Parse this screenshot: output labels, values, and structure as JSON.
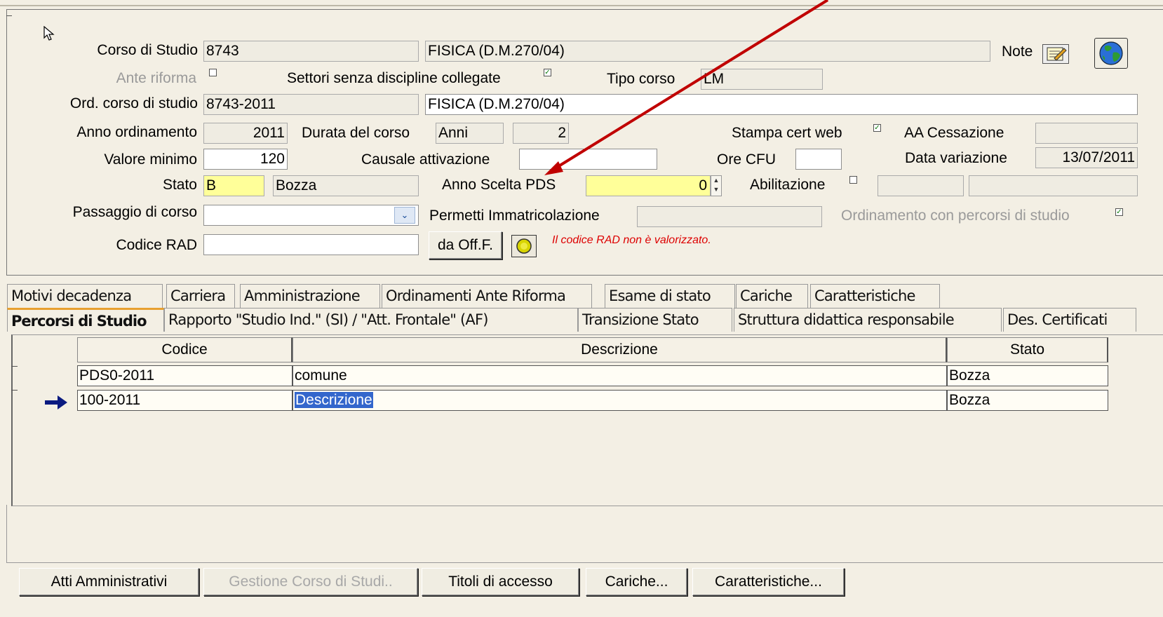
{
  "form": {
    "corso_di_studio_label": "Corso di Studio",
    "corso_code": "8743",
    "corso_name": "FISICA (D.M.270/04)",
    "note_label": "Note",
    "ante_riforma_label": "Ante riforma",
    "settori_label": "Settori senza discipline collegate",
    "tipo_corso_label": "Tipo corso",
    "tipo_corso_value": "LM",
    "ord_corso_label": "Ord. corso di studio",
    "ord_corso_code": "8743-2011",
    "ord_corso_name": "FISICA (D.M.270/04)",
    "anno_ordinamento_label": "Anno ordinamento",
    "anno_ordinamento_value": "2011",
    "durata_label": "Durata del corso",
    "durata_unit": "Anni",
    "durata_value": "2",
    "stampa_cert_label": "Stampa cert web",
    "aa_cessazione_label": "AA Cessazione",
    "aa_cessazione_value": "",
    "valore_minimo_label": "Valore minimo",
    "valore_minimo_value": "120",
    "causale_label": "Causale attivazione",
    "causale_value": "",
    "ore_cfu_label": "Ore CFU",
    "ore_cfu_value": "",
    "data_variazione_label": "Data variazione",
    "data_variazione_value": "13/07/2011",
    "stato_label": "Stato",
    "stato_code": "B",
    "stato_desc": "Bozza",
    "anno_scelta_label": "Anno Scelta PDS",
    "anno_scelta_value": "0",
    "abilitazione_label": "Abilitazione",
    "passaggio_label": "Passaggio di corso",
    "passaggio_value": "",
    "permetti_label": "Permetti Immatricolazione",
    "ordinamento_percorsi_label": "Ordinamento con percorsi di studio",
    "codice_rad_label": "Codice RAD",
    "codice_rad_value": "",
    "da_off_label": "da Off.F.",
    "rad_warning": "Il codice RAD non è valorizzato."
  },
  "tabs_row1": [
    "Motivi decadenza",
    "Carriera",
    "Amministrazione",
    "Ordinamenti Ante Riforma",
    "Esame di stato",
    "Cariche",
    "Caratteristiche"
  ],
  "tabs_row2": [
    "Percorsi di Studio",
    "Rapporto \"Studio Ind.\" (SI) / \"Att. Frontale\" (AF)",
    "Transizione Stato",
    "Struttura didattica responsabile",
    "Des. Certificati"
  ],
  "table": {
    "headers": [
      "Codice",
      "Descrizione",
      "Stato"
    ],
    "rows": [
      {
        "codice": "PDS0-2011",
        "descrizione": "comune",
        "stato": "Bozza"
      },
      {
        "codice": "100-2011",
        "descrizione": "Descrizione",
        "stato": "Bozza"
      }
    ]
  },
  "buttons": {
    "atti": "Atti Amministrativi",
    "gestione": "Gestione Corso di Studi..",
    "titoli": "Titoli di accesso",
    "cariche": "Cariche...",
    "caratteristiche": "Caratteristiche..."
  },
  "colors": {
    "background": "#f3efe4",
    "highlight_field": "#ffff99",
    "warning_text": "#dd0000",
    "annotation_arrow": "#c00000",
    "selection": "#3366cc"
  }
}
